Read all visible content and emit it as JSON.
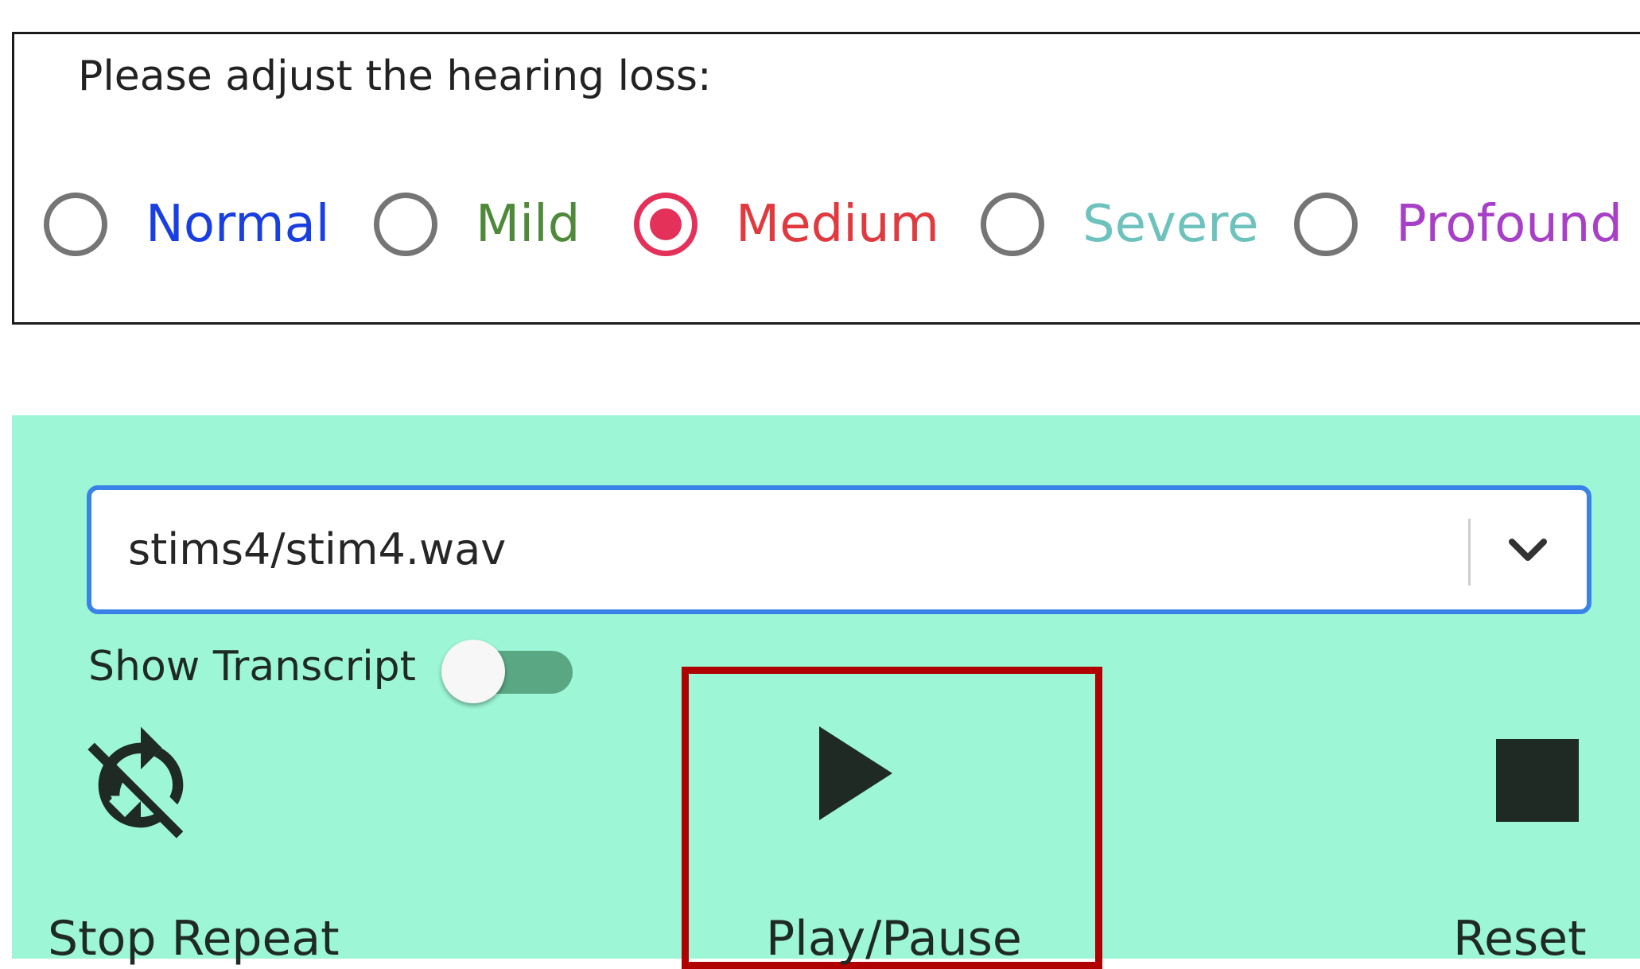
{
  "hearing_loss": {
    "prompt": "Please adjust the hearing loss:",
    "selected": "Medium",
    "options": [
      {
        "label": "Normal",
        "color": "#1a3fe0",
        "checked": false
      },
      {
        "label": "Mild",
        "color": "#4e8a3a",
        "checked": false
      },
      {
        "label": "Medium",
        "color": "#e0393e",
        "checked": true
      },
      {
        "label": "Severe",
        "color": "#6ec2bd",
        "checked": false
      },
      {
        "label": "Profound",
        "color": "#a840c7",
        "checked": false
      }
    ]
  },
  "player": {
    "background": "#9df7d6",
    "file_select": {
      "value": "stims4/stim4.wav",
      "icon": "chevron-down-icon"
    },
    "transcript": {
      "label": "Show Transcript",
      "on": false
    },
    "controls": {
      "stop_repeat": {
        "label": "Stop Repeat",
        "icon": "repeat-off-icon"
      },
      "play_pause": {
        "label": "Play/Pause",
        "icon": "play-icon",
        "highlighted": true
      },
      "reset": {
        "label": "Reset",
        "icon": "stop-icon"
      }
    }
  }
}
